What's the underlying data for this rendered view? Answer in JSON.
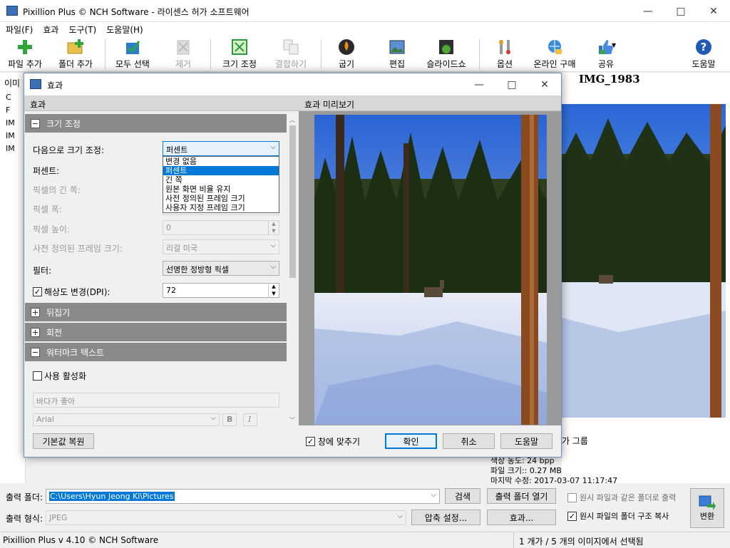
{
  "app": {
    "title": "Pixillion Plus © NCH Software - 라이센스 허가 소프트웨어"
  },
  "menu": [
    "파일(F)",
    "효과",
    "도구(T)",
    "도움말(H)"
  ],
  "toolbar": {
    "add_file": "파일 추가",
    "add_folder": "폴더 추가",
    "select_all": "모두 선택",
    "remove": "제거",
    "resize": "크기 조정",
    "combine": "결합하기",
    "burn": "굽기",
    "edit": "편집",
    "slideshow": "슬라이드쇼",
    "options": "옵션",
    "buy_online": "온라인 구매",
    "share": "공유",
    "help": "도움말"
  },
  "main": {
    "list_header": "이미",
    "list_items": [
      "C",
      "F",
      "IM",
      "IM",
      "IM"
    ],
    "preview_title": "IMG_1983",
    "right_frag": "가 그룹",
    "info": {
      "color_depth": "색상 농도: 24 bpp",
      "file_size": "파일 크기:: 0.27 MB",
      "modified": "마지막 수정: 2017-03-07 11:17:47"
    }
  },
  "output": {
    "folder_label": "출력 폴더:",
    "folder_value": "C:\\Users\\Hyun Jeong Ki\\Pictures",
    "browse": "검색",
    "open_folder": "출력 폴더 열기",
    "format_label": "출력 형식:",
    "format_value": "JPEG",
    "compression": "압축 설정...",
    "effects": "효과...",
    "same_folder": "원시 파일과 같은 폴더로 출력",
    "keep_structure": "원시 파일의 폴더 구조 복사",
    "convert": "변환"
  },
  "status": {
    "left": "Pixillion Plus v 4.10 © NCH Software",
    "right": "1 개가 / 5 개의 이미지에서 선택됨"
  },
  "dialog": {
    "title": "효과",
    "left_header": "효과",
    "right_header": "효과 미리보기",
    "resize_section": "크기 조정",
    "resize_by_label": "다음으로 크기 조정:",
    "resize_by_value": "퍼센트",
    "resize_options": [
      "변경 없음",
      "퍼센트",
      "긴 쪽",
      "원본 화면 비율 유지",
      "사전 정의된 프레임 크기",
      "사용자 지정 프레임 크기"
    ],
    "percent_label": "퍼센트:",
    "long_side_label": "픽셀의 긴 쪽:",
    "width_label": "픽셀 폭:",
    "height_label": "픽셀 높이:",
    "height_value": "0",
    "preset_label": "사전 정의된 프레임 크기:",
    "preset_value": "리걸 미국",
    "filter_label": "필터:",
    "filter_value": "선명한 정방형 픽셀",
    "dpi_label": "해상도 변경(DPI):",
    "dpi_value": "72",
    "flip_section": "뒤집기",
    "rotate_section": "회전",
    "watermark_section": "워터마크 텍스트",
    "enable_label": "사용 활성화",
    "watermark_text": "바다가 좋아",
    "font_value": "Arial",
    "bold": "B",
    "italic": "I",
    "reset": "기본값 복원",
    "fit_window": "창에 맞추기",
    "ok": "확인",
    "cancel": "취소",
    "help": "도움말"
  }
}
